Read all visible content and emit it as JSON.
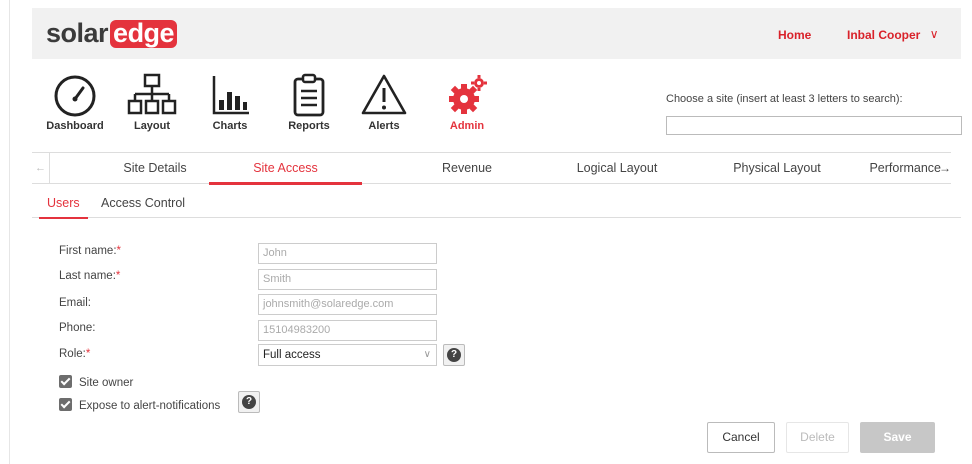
{
  "header": {
    "logo_left": "solar",
    "logo_right": "edge",
    "home": "Home",
    "user": "Inbal Cooper",
    "user_chevron": "∨"
  },
  "nav": [
    {
      "label": "Dashboard",
      "icon": "dashboard-gauge-icon"
    },
    {
      "label": "Layout",
      "icon": "layout-hierarchy-icon"
    },
    {
      "label": "Charts",
      "icon": "charts-bar-icon"
    },
    {
      "label": "Reports",
      "icon": "reports-clipboard-icon"
    },
    {
      "label": "Alerts",
      "icon": "alerts-warning-icon"
    },
    {
      "label": "Admin",
      "icon": "admin-gears-icon",
      "active": true
    }
  ],
  "site_search": {
    "label": "Choose a site (insert at least 3 letters to search):",
    "value": ""
  },
  "main_tabs": [
    "Site Details",
    "Site Access",
    "Revenue",
    "Logical Layout",
    "Physical Layout",
    "Performance"
  ],
  "main_tabs_active": "Site Access",
  "sub_tabs": [
    "Users",
    "Access Control"
  ],
  "sub_tabs_active": "Users",
  "form": {
    "first_name_label": "First name:",
    "first_name_value": "John",
    "last_name_label": "Last name:",
    "last_name_value": "Smith",
    "email_label": "Email:",
    "email_value": "johnsmith@solaredge.com",
    "phone_label": "Phone:",
    "phone_value": "15104983200",
    "role_label": "Role:",
    "role_value": "Full access",
    "required_mark": "*",
    "site_owner_label": "Site owner",
    "site_owner_checked": true,
    "expose_label": "Expose to alert-notifications",
    "expose_checked": true,
    "help_glyph": "?"
  },
  "buttons": {
    "cancel": "Cancel",
    "delete": "Delete",
    "save": "Save"
  },
  "colors": {
    "accent": "#e4333d",
    "header_bg": "#f1f1f1"
  }
}
